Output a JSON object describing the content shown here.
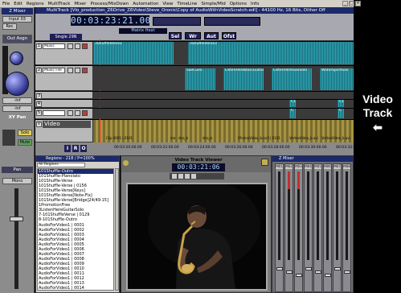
{
  "menu": [
    "File",
    "Edit",
    "Regions",
    "MultiTrack",
    "Mixer",
    "Process/MixDown",
    "Automation",
    "View",
    "TimeLine",
    "Simple/Mid",
    "Options",
    "Info"
  ],
  "left_panel": {
    "title": "Z Mixer",
    "input": "Input 03",
    "rec": "Rec",
    "out": "Out Asgn",
    "send": "-Inf",
    "xy_pan": "XY Pan",
    "solo": "Solo",
    "mute": "Mute",
    "pan": "Pan",
    "mono": "Mono"
  },
  "multitrack": {
    "title": "MultiTrack [Vlo_production_Z6Drive_Z6Video\\Steve_Oronis\\Copy of AudioWithVideoScratch.edl] - 44100 Hz, 16 Bits, Dither Off",
    "timecode": "00:03:23:21.00",
    "single": "Single 29N",
    "matrix_label": "Matrix Heat",
    "buttons": [
      "Sel",
      "Wr",
      "Aut",
      "Ofst"
    ],
    "tracks": [
      {
        "num": "1",
        "name": "Music",
        "clips": [
          "3ShuffleVerse2",
          "3ShuffleVerse3"
        ]
      },
      {
        "num": "2",
        "name": "Music File",
        "clips": [
          "SaxCues",
          "ListenHereBassGuitar",
          "ListenHereSaxSolo",
          "WaterSpiritSax"
        ]
      },
      {
        "num": "3",
        "name": "",
        "clips": []
      },
      {
        "num": "4",
        "name": "",
        "clips": [
          "C1",
          "C1"
        ]
      },
      {
        "num": "5",
        "name": "",
        "clips": [
          "C",
          "C"
        ]
      }
    ],
    "video_track_label": "Video",
    "video_clips": [
      "Clip 0001 | 0101",
      "ma",
      "dna_b",
      "dna_b",
      "[PromoVideo_b.avi] | 0101",
      "VortexVideo_b.avi",
      "VortexVideo_b.avi"
    ],
    "transport": [
      "I",
      "R",
      "O"
    ],
    "ruler": [
      "00:03:20:00.00",
      "00:03:22:00.00",
      "00:03:24:00.00",
      "00:03:26:00.00",
      "00:03:28:00.00",
      "00:03:30:00.00",
      "00:03:32:00.00"
    ]
  },
  "regions": {
    "title": "Regions - 218 / P=100%",
    "filter": "All Regions",
    "items": [
      "101Shuffle-Outro",
      "101Shuffle-Planolato",
      "101Shuffle-Verse",
      "101Shuffle-Verse | 0156",
      "101Shuffle-Verse[Keys]",
      "101Shuffle-Verse[Note-Fix]",
      "101Shuffle-Verse[Bridge]24/49:15]",
      "1PromotionFree",
      "3ListenHereGuitarSolo",
      "7-101ShuffleVerse | 0129",
      "8-101Shuffle-Outro",
      "AudioForVideo1 | 0001",
      "AudioForVideo1 | 0002",
      "AudioForVideo1 | 0003",
      "AudioForVideo1 | 0004",
      "AudioForVideo1 | 0005",
      "AudioForVideo1 | 0006",
      "AudioForVideo1 | 0007",
      "AudioForVideo1 | 0008",
      "AudioForVideo1 | 0009",
      "AudioForVideo1 | 0010",
      "AudioForVideo1 | 0011",
      "AudioForVideo1 | 0012",
      "AudioForVideo1 | 0013",
      "AudioForVideo1 | 0014",
      "AudioForVideo1 | 0015"
    ]
  },
  "viewer": {
    "title": "Video Track Viewer",
    "timecode": "00:03:21:06"
  },
  "mixer": {
    "title": "Z Mixer",
    "strips": [
      "M01",
      "M02",
      "M03",
      "M04",
      "M05",
      "M06",
      "M07",
      "M08"
    ]
  },
  "annotation": {
    "line1": "Video",
    "line2": "Track",
    "arrow": "⬅"
  },
  "colors": {
    "title_bar": "#1c2a6b",
    "wave": "#2ca6b4",
    "video_lane": "#a79444",
    "timecode_text": "#a8d8ff"
  }
}
